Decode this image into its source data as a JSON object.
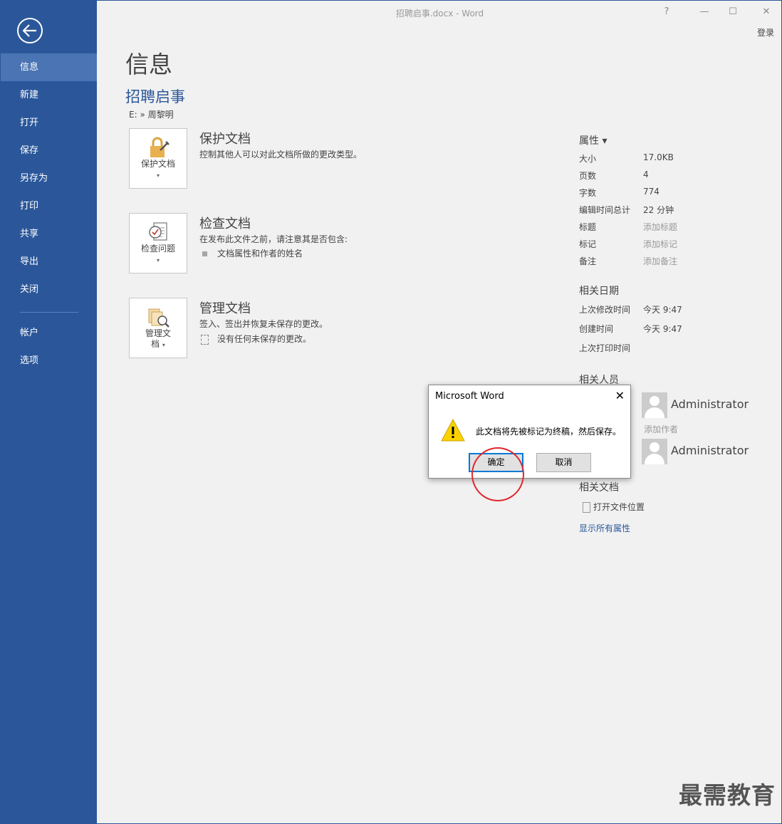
{
  "window": {
    "title": "招聘启事.docx - Word",
    "help": "?",
    "minimize": "—",
    "restore": "☐",
    "close": "✕",
    "signin": "登录"
  },
  "sidebar": {
    "items": [
      {
        "label": "信息"
      },
      {
        "label": "新建"
      },
      {
        "label": "打开"
      },
      {
        "label": "保存"
      },
      {
        "label": "另存为"
      },
      {
        "label": "打印"
      },
      {
        "label": "共享"
      },
      {
        "label": "导出"
      },
      {
        "label": "关闭"
      },
      {
        "label": "帐户"
      },
      {
        "label": "选项"
      }
    ]
  },
  "main": {
    "page_title": "信息",
    "doc_title": "招聘启事",
    "doc_path": "E: » 周黎明",
    "sections": [
      {
        "tile_label": "保护文档",
        "heading": "保护文档",
        "desc": "控制其他人可以对此文档所做的更改类型。"
      },
      {
        "tile_label": "检查问题",
        "heading": "检查文档",
        "desc": "在发布此文件之前，请注意其是否包含:",
        "bullet": "文档属性和作者的姓名"
      },
      {
        "tile_label_line1": "管理文",
        "tile_label_line2": "档",
        "heading": "管理文档",
        "desc": "签入、签出并恢复未保存的更改。",
        "bullet": "没有任何未保存的更改。"
      }
    ],
    "caret": "▾"
  },
  "properties": {
    "heading": "属性 ▾",
    "rows": [
      {
        "key": "大小",
        "value": "17.0KB"
      },
      {
        "key": "页数",
        "value": "4"
      },
      {
        "key": "字数",
        "value": "774"
      },
      {
        "key": "编辑时间总计",
        "value": "22 分钟"
      },
      {
        "key": "标题",
        "value": "添加标题"
      },
      {
        "key": "标记",
        "value": "添加标记"
      },
      {
        "key": "备注",
        "value": "添加备注"
      }
    ],
    "dates_heading": "相关日期",
    "dates": [
      {
        "key": "上次修改时间",
        "value": "今天 9:47"
      },
      {
        "key": "创建时间",
        "value": "今天 9:47"
      },
      {
        "key": "上次打印时间",
        "value": ""
      }
    ],
    "people_heading": "相关人员",
    "author": "Administrator",
    "add_author": "添加作者",
    "last_modified_by": "Administrator",
    "docs_heading": "相关文档",
    "open_location": "打开文件位置",
    "show_all": "显示所有属性"
  },
  "dialog": {
    "title": "Microsoft Word",
    "close": "✕",
    "message": "此文档将先被标记为终稿，然后保存。",
    "ok": "确定",
    "cancel": "取消"
  },
  "watermark": "最需教育",
  "colors": {
    "accent": "#2b579a",
    "active_nav": "#4a74b3",
    "highlight_circle": "#e0262d"
  }
}
